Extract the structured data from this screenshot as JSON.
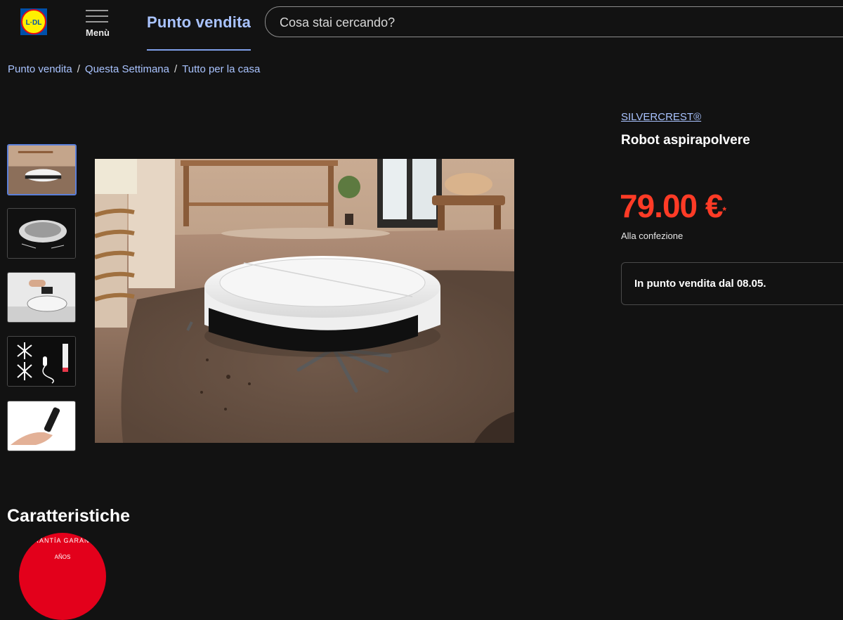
{
  "header": {
    "menu_label": "Menù",
    "tab_label": "Punto vendita",
    "search_placeholder": "Cosa stai cercando?"
  },
  "breadcrumb": [
    "Punto vendita",
    "Questa Settimana",
    "Tutto per la casa"
  ],
  "product": {
    "brand": "SILVERCREST®",
    "title": "Robot aspirapolvere",
    "price": "79.00 €",
    "price_mark": "*",
    "unit": "Alla confezione",
    "availability": "In punto vendita dal 08.05."
  },
  "gallery": {
    "thumbnails": [
      "robot-in-room",
      "robot-top-view",
      "robot-hand-lift",
      "accessories",
      "remote-in-hand"
    ],
    "selected_index": 0
  },
  "features": {
    "heading": "Caratteristiche",
    "badge_text": "GARANTÍA  GARANZIA",
    "badge_sub": "AÑOS"
  },
  "colors": {
    "background": "#121212",
    "accent_link": "#a9c3ff",
    "price": "#ff3b26",
    "badge": "#e3001b"
  }
}
